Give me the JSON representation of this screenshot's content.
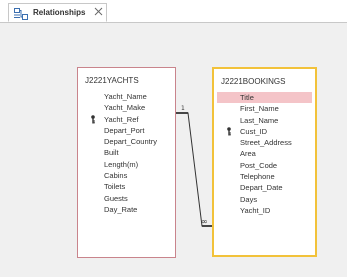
{
  "tab": {
    "label": "Relationships"
  },
  "tables": {
    "yachts": {
      "title": "J2221YACHTS",
      "fields": [
        {
          "name": "Yacht_Name",
          "key": false
        },
        {
          "name": "Yacht_Make",
          "key": false
        },
        {
          "name": "Yacht_Ref",
          "key": true
        },
        {
          "name": "Depart_Port",
          "key": false
        },
        {
          "name": "Depart_Country",
          "key": false
        },
        {
          "name": "Built",
          "key": false
        },
        {
          "name": "Length(m)",
          "key": false
        },
        {
          "name": "Cabins",
          "key": false
        },
        {
          "name": "Toilets",
          "key": false
        },
        {
          "name": "Guests",
          "key": false
        },
        {
          "name": "Day_Rate",
          "key": false
        }
      ]
    },
    "bookings": {
      "title": "J2221BOOKINGS",
      "fields": [
        {
          "name": "Title",
          "key": false,
          "selected": true
        },
        {
          "name": "First_Name",
          "key": false
        },
        {
          "name": "Last_Name",
          "key": false
        },
        {
          "name": "Cust_ID",
          "key": true
        },
        {
          "name": "Street_Address",
          "key": false
        },
        {
          "name": "Area",
          "key": false
        },
        {
          "name": "Post_Code",
          "key": false
        },
        {
          "name": "Telephone",
          "key": false
        },
        {
          "name": "Depart_Date",
          "key": false
        },
        {
          "name": "Days",
          "key": false
        },
        {
          "name": "Yacht_ID",
          "key": false
        }
      ]
    }
  },
  "relationship": {
    "one_side": "1",
    "many_side": "∞"
  },
  "colors": {
    "selected_row": "#f4c4c8",
    "active_border": "#f2c23a",
    "table_border": "#c9848c"
  }
}
